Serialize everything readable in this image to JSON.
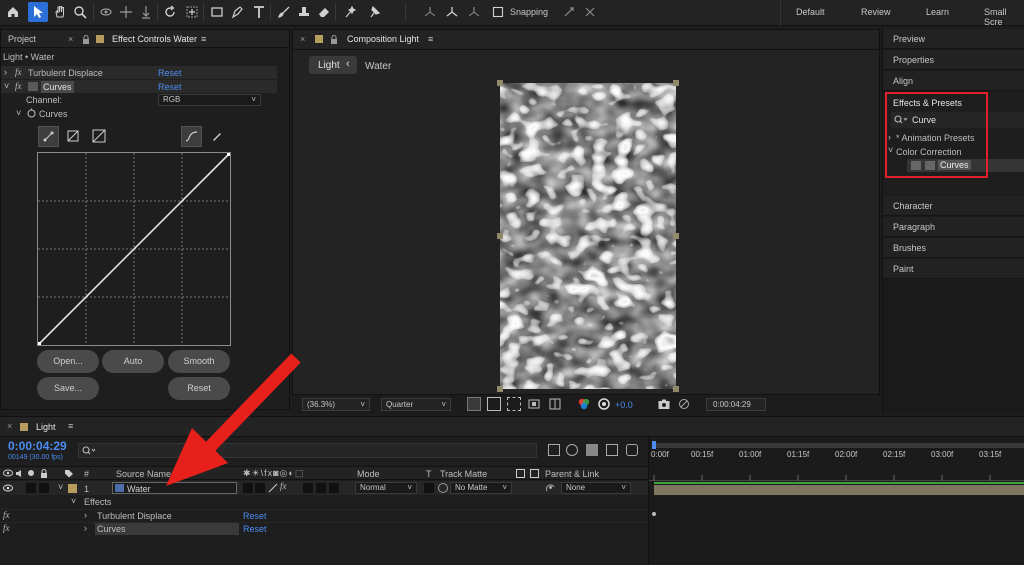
{
  "toolbar": {
    "snapping_label": "Snapping",
    "workspaces": [
      "Default",
      "Review",
      "Learn",
      "Small Scre"
    ]
  },
  "left_panel": {
    "tab_project": "Project",
    "tab_effect_controls": "Effect Controls Water",
    "breadcrumb": "Light • Water",
    "effects": [
      {
        "name": "Turbulent Displace",
        "reset": "Reset"
      },
      {
        "name": "Curves",
        "reset": "Reset"
      }
    ],
    "channel_label": "Channel:",
    "channel_value": "RGB",
    "curves_label": "Curves",
    "buttons": {
      "open": "Open...",
      "auto": "Auto",
      "smooth": "Smooth",
      "save": "Save...",
      "reset": "Reset"
    }
  },
  "comp_panel": {
    "tab_title": "Composition Light",
    "crumb_light": "Light",
    "crumb_water": "Water",
    "zoom": "(36.3%)",
    "resolution": "Quarter",
    "exposure": "+0.0",
    "timecode": "0:00:04:29"
  },
  "right_panel": {
    "items_top": [
      "Preview",
      "Properties",
      "Align"
    ],
    "effects_presets_title": "Effects & Presets",
    "search_value": "Curve",
    "tree": {
      "animation_presets": "* Animation Presets",
      "color_correction": "Color Correction",
      "curves_item": "Curves"
    },
    "items_bottom": [
      "Character",
      "Paragraph",
      "Brushes",
      "Paint"
    ],
    "highlight_color": "#e0202a"
  },
  "timeline": {
    "tab_title": "Light",
    "timecode": "0:00:04:29",
    "frame_info": "00149 (30.00 fps)",
    "columns": {
      "number": "#",
      "source_name": "Source Name",
      "mode": "Mode",
      "t": "T",
      "track_matte": "Track Matte",
      "parent_link": "Parent & Link"
    },
    "layer": {
      "number": "1",
      "name": "Water",
      "mode": "Normal",
      "track_matte": "No Matte",
      "parent": "None"
    },
    "effects_group": "Effects",
    "effect_rows": [
      {
        "name": "Turbulent Displace",
        "reset": "Reset"
      },
      {
        "name": "Curves",
        "reset": "Reset"
      }
    ],
    "ruler_labels": [
      "0:00f",
      "00:15f",
      "01:00f",
      "01:15f",
      "02:00f",
      "02:15f",
      "03:00f",
      "03:15f"
    ]
  },
  "annotation": {
    "arrow_color": "#e8201c"
  }
}
